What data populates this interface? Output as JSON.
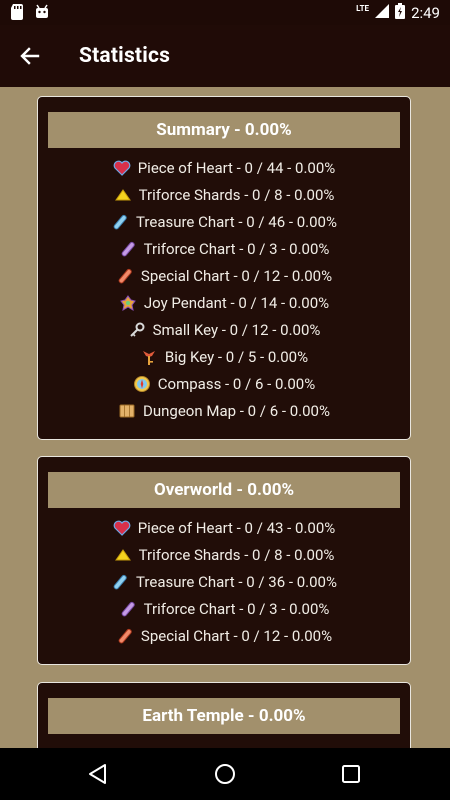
{
  "status": {
    "network": "LTE",
    "time": "2:49"
  },
  "header": {
    "title": "Statistics"
  },
  "cards": [
    {
      "title": "Summary - 0.00%",
      "rows": [
        {
          "icon": "heart",
          "text": "Piece of Heart - 0 / 44 - 0.00%"
        },
        {
          "icon": "triforce",
          "text": "Triforce Shards - 0 / 8 - 0.00%"
        },
        {
          "icon": "chart-blue",
          "text": "Treasure Chart - 0 / 46 - 0.00%"
        },
        {
          "icon": "chart-purple",
          "text": "Triforce Chart - 0 / 3 - 0.00%"
        },
        {
          "icon": "chart-red",
          "text": "Special Chart - 0 / 12 - 0.00%"
        },
        {
          "icon": "pendant",
          "text": "Joy Pendant - 0 / 14 - 0.00%"
        },
        {
          "icon": "small-key",
          "text": "Small Key - 0 / 12 - 0.00%"
        },
        {
          "icon": "big-key",
          "text": "Big Key - 0 / 5 - 0.00%"
        },
        {
          "icon": "compass",
          "text": "Compass - 0 / 6 - 0.00%"
        },
        {
          "icon": "map",
          "text": "Dungeon Map - 0 / 6 - 0.00%"
        }
      ]
    },
    {
      "title": "Overworld - 0.00%",
      "rows": [
        {
          "icon": "heart",
          "text": "Piece of Heart - 0 / 43 - 0.00%"
        },
        {
          "icon": "triforce",
          "text": "Triforce Shards - 0 / 8 - 0.00%"
        },
        {
          "icon": "chart-blue",
          "text": "Treasure Chart - 0 / 36 - 0.00%"
        },
        {
          "icon": "chart-purple",
          "text": "Triforce Chart - 0 / 3 - 0.00%"
        },
        {
          "icon": "chart-red",
          "text": "Special Chart - 0 / 12 - 0.00%"
        }
      ]
    },
    {
      "title": "Earth Temple - 0.00%",
      "rows": []
    }
  ],
  "colors": {
    "background": "#a2906c",
    "card": "#210d08",
    "header_band": "#a2906c",
    "app_bar": "#200b07"
  }
}
